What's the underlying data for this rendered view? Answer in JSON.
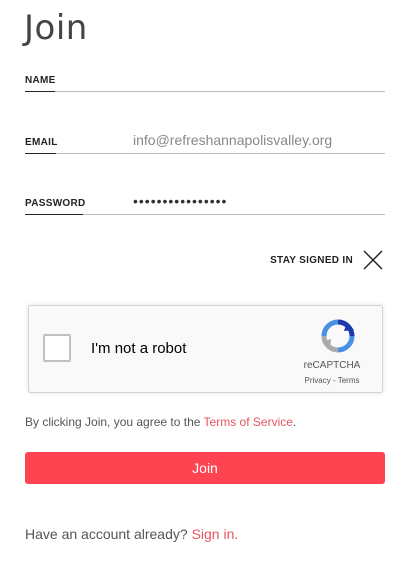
{
  "form": {
    "title": "Join",
    "fields": {
      "name": {
        "label": "NAME",
        "value": "",
        "placeholder": ""
      },
      "email": {
        "label": "EMAIL",
        "value": "info@refreshannapolisvalley.org",
        "placeholder": ""
      },
      "password": {
        "label": "PASSWORD",
        "value": "••••••••••••••••",
        "placeholder": ""
      }
    },
    "stay_signed_in": {
      "label": "STAY SIGNED IN",
      "icon": "close-x-icon"
    }
  },
  "captcha": {
    "label": "I'm not a robot",
    "brand": "reCAPTCHA",
    "privacy": "Privacy",
    "separator": " - ",
    "terms": "Terms",
    "icon": "recaptcha-logo-icon"
  },
  "legal": {
    "prefix": "By clicking Join, you agree to the ",
    "link": "Terms of Service",
    "suffix": "."
  },
  "join_button": {
    "label": "Join"
  },
  "signin": {
    "prompt": "Have an account already? ",
    "link": "Sign in."
  },
  "colors": {
    "accent": "#ff4451",
    "link": "#e9545f",
    "text": "#333333",
    "muted": "#888888"
  }
}
